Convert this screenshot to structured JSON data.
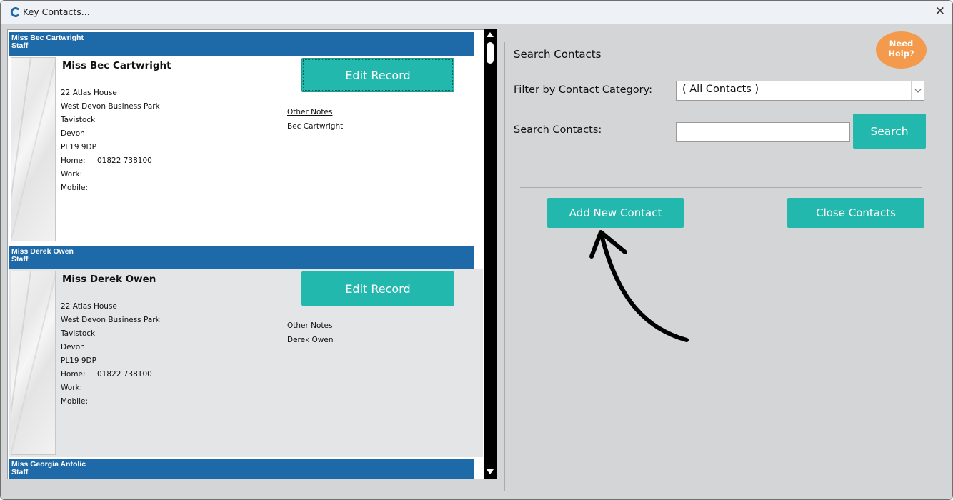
{
  "window": {
    "title": "Key Contacts...",
    "close_glyph": "✕",
    "app_icon": "c-logo-icon"
  },
  "contacts": [
    {
      "header_name": "Miss Bec Cartwright",
      "header_category": "Staff",
      "name": "Miss Bec Cartwright",
      "address": [
        "22 Atlas House",
        "West Devon Business Park",
        "Tavistock",
        "Devon",
        "PL19 9DP"
      ],
      "home_label": "Home:",
      "home": "01822 738100",
      "work_label": "Work:",
      "work": "",
      "mobile_label": "Mobile:",
      "mobile": "",
      "edit_label": "Edit Record",
      "notes_label": "Other Notes",
      "notes": "Bec Cartwright"
    },
    {
      "header_name": "Miss Derek Owen",
      "header_category": "Staff",
      "name": "Miss Derek Owen",
      "address": [
        "22 Atlas House",
        "West Devon Business Park",
        "Tavistock",
        "Devon",
        "PL19 9DP"
      ],
      "home_label": "Home:",
      "home": "01822 738100",
      "work_label": "Work:",
      "work": "",
      "mobile_label": "Mobile:",
      "mobile": "",
      "edit_label": "Edit Record",
      "notes_label": "Other Notes",
      "notes": "Derek Owen"
    },
    {
      "header_name": "Miss Georgia Antolic",
      "header_category": "Staff"
    }
  ],
  "search": {
    "title": "Search Contacts",
    "help_line1": "Need",
    "help_line2": "Help?",
    "filter_label": "Filter by Contact Category:",
    "filter_value": "( All Contacts )",
    "search_label": "Search Contacts:",
    "search_value": "",
    "search_button": "Search",
    "add_button": "Add New Contact",
    "close_button": "Close Contacts"
  },
  "colors": {
    "accent": "#22b8ad",
    "header_blue": "#1e6aa8",
    "help_orange": "#f39a4d",
    "background": "#d4d5d7"
  }
}
